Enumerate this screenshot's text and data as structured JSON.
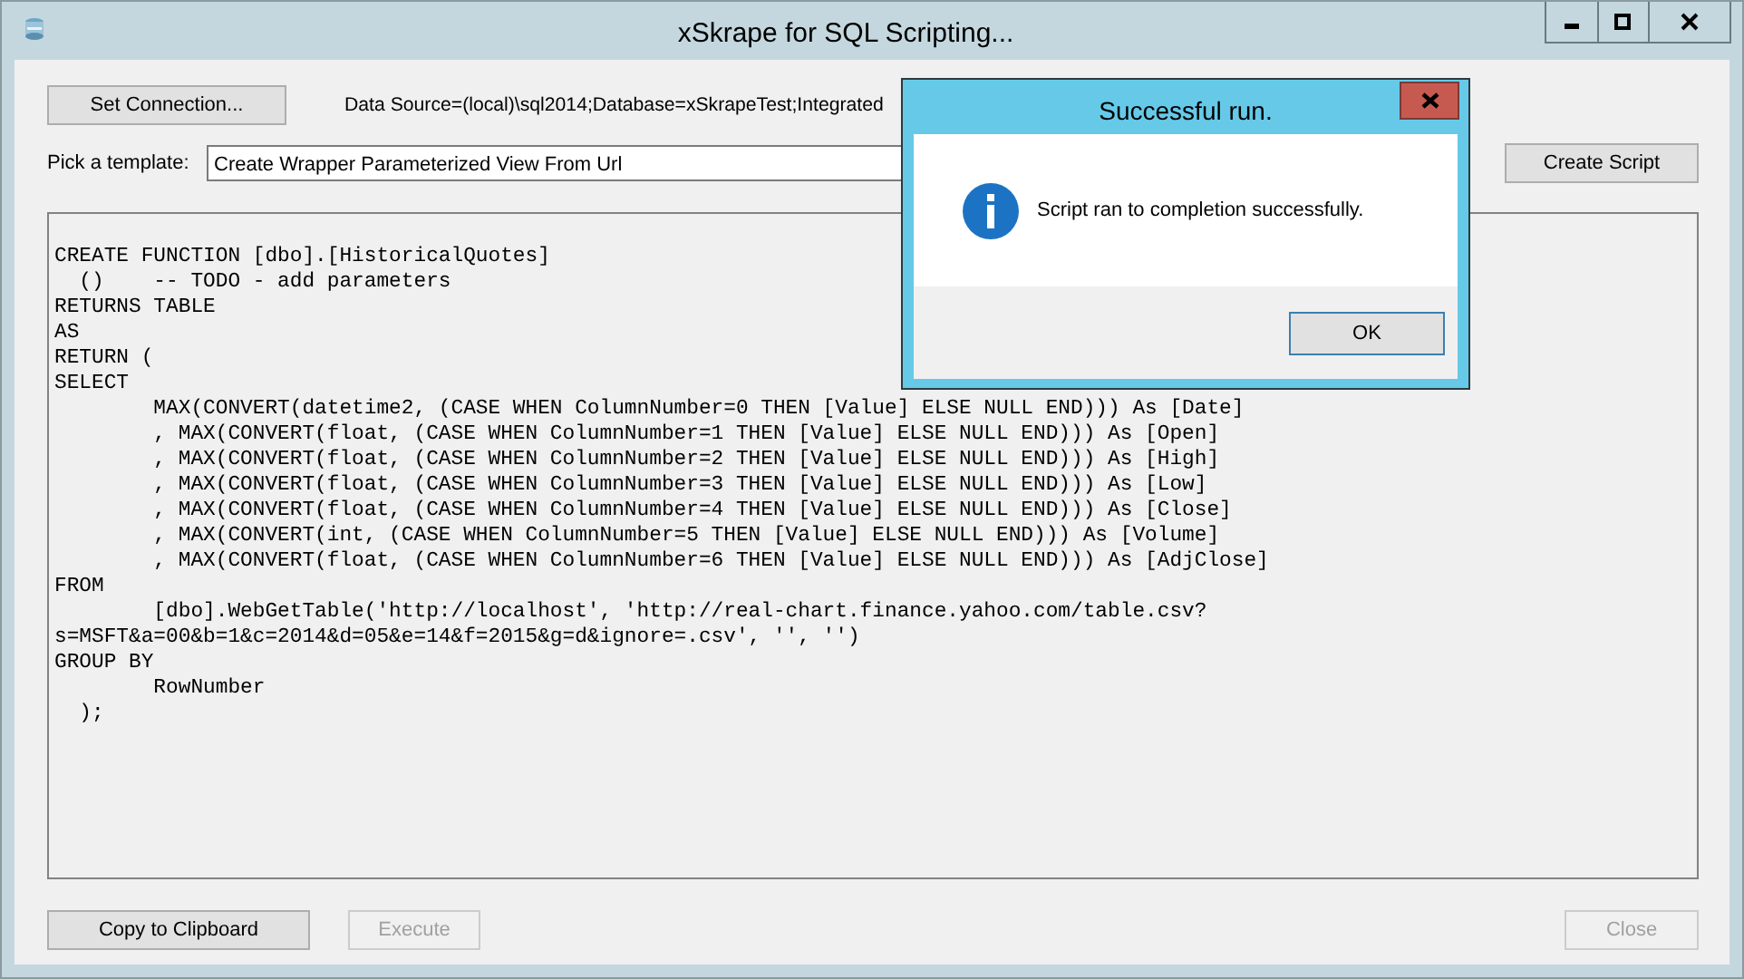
{
  "window": {
    "title": "xSkrape for SQL Scripting..."
  },
  "connection": {
    "button": "Set Connection...",
    "string": "Data Source=(local)\\sql2014;Database=xSkrapeTest;Integrated"
  },
  "template": {
    "label": "Pick a template:",
    "value": "Create Wrapper Parameterized View From Url"
  },
  "create_button": "Create Script",
  "script": {
    "lines": [
      "CREATE FUNCTION [dbo].[HistoricalQuotes]",
      "  ()    -- TODO - add parameters",
      "RETURNS TABLE",
      "AS",
      "RETURN (",
      "SELECT",
      "        MAX(CONVERT(datetime2, (CASE WHEN ColumnNumber=0 THEN [Value] ELSE NULL END))) As [Date]",
      "        , MAX(CONVERT(float, (CASE WHEN ColumnNumber=1 THEN [Value] ELSE NULL END))) As [Open]",
      "        , MAX(CONVERT(float, (CASE WHEN ColumnNumber=2 THEN [Value] ELSE NULL END))) As [High]",
      "        , MAX(CONVERT(float, (CASE WHEN ColumnNumber=3 THEN [Value] ELSE NULL END))) As [Low]",
      "        , MAX(CONVERT(float, (CASE WHEN ColumnNumber=4 THEN [Value] ELSE NULL END))) As [Close]",
      "        , MAX(CONVERT(int, (CASE WHEN ColumnNumber=5 THEN [Value] ELSE NULL END))) As [Volume]",
      "        , MAX(CONVERT(float, (CASE WHEN ColumnNumber=6 THEN [Value] ELSE NULL END))) As [AdjClose]",
      "FROM",
      "        [dbo].WebGetTable('http://localhost', 'http://real-chart.finance.yahoo.com/table.csv?",
      "s=MSFT&a=00&b=1&c=2014&d=05&e=14&f=2015&g=d&ignore=.csv', '', '')",
      "GROUP BY",
      "        RowNumber",
      "  );"
    ]
  },
  "buttons": [
    {
      "label": "Copy to Clipboard",
      "disabled": false
    },
    {
      "label": "Execute",
      "disabled": true
    },
    {
      "label": "Close",
      "disabled": true
    }
  ],
  "dialog": {
    "title": "Successful run.",
    "message": "Script ran to completion successfully.",
    "ok": "OK"
  }
}
